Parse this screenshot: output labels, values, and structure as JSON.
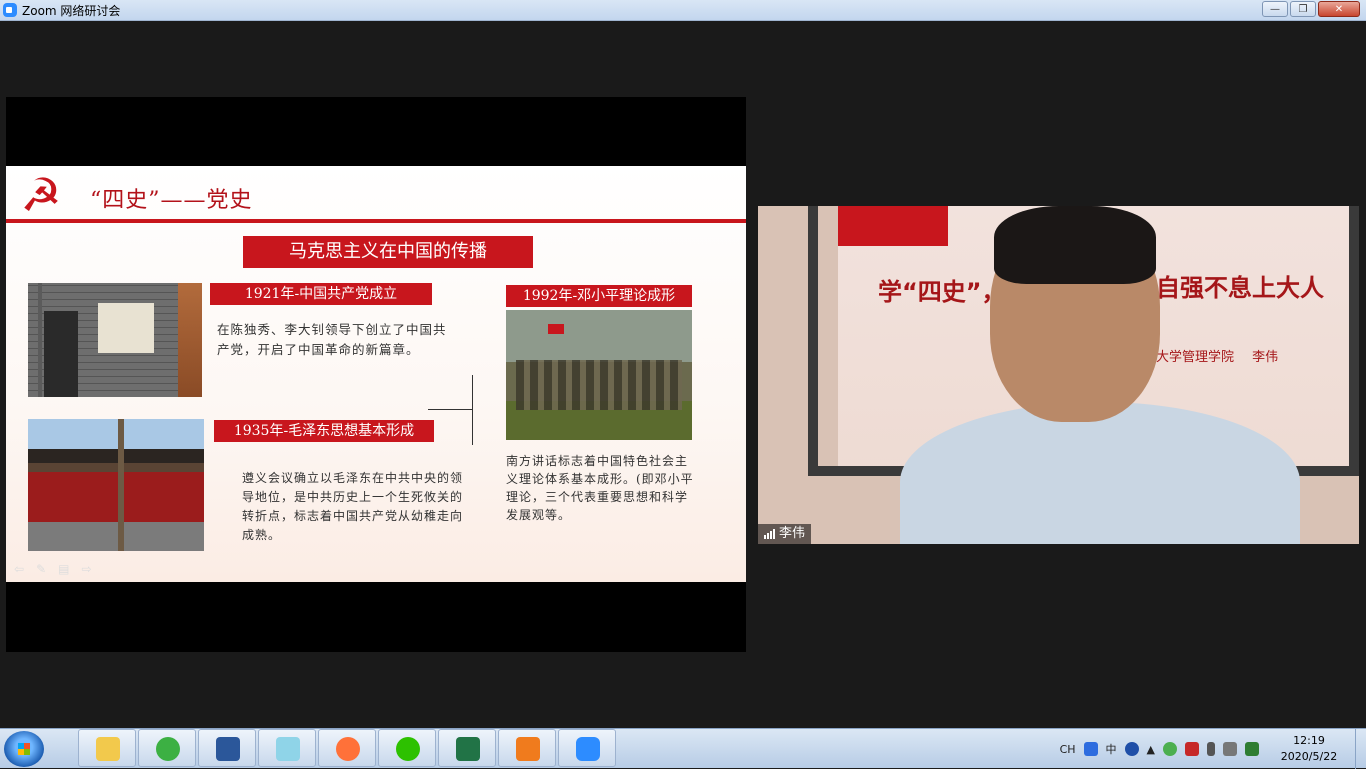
{
  "window": {
    "title": "Zoom 网络研讨会"
  },
  "window_buttons": {
    "minimize": "—",
    "maximize": "❐",
    "close": "✕"
  },
  "slide": {
    "title": "“四史”——党史",
    "banner": "马克思主义在中国的传播",
    "events": [
      {
        "label": "1921年-中国共产党成立",
        "desc": "在陈独秀、李大钊领导下创立了中国共产党，开启了中国革命的新篇章。"
      },
      {
        "label": "1935年-毛泽东思想基本形成",
        "desc": "遵义会议确立以毛泽东在中共中央的领导地位，是中共历史上一个生死攸关的转折点，标志着中国共产党从幼稚走向成熟。"
      },
      {
        "label": "1992年-邓小平理论成形",
        "desc": "南方讲话标志着中国特色社会主义理论体系基本成形。(即邓小平理论，三个代表重要思想和科学发展观等。"
      }
    ]
  },
  "video": {
    "participant_name": "李伟",
    "background_text_left": "学“四史”，",
    "background_text_right": "自强不息上大人",
    "background_subtitle": "大学管理学院 李伟"
  },
  "taskbar": {
    "apps": [
      "file-explorer",
      "ie-browser",
      "word",
      "notepad",
      "firefox",
      "wechat",
      "excel",
      "pdf-reader",
      "zoom"
    ],
    "tray_ime": "CH",
    "tray_lang": "中",
    "clock_time": "12:19",
    "clock_date": "2020/5/22"
  },
  "colors": {
    "party_red": "#c8161d",
    "zoom_blue": "#2d8cff"
  }
}
